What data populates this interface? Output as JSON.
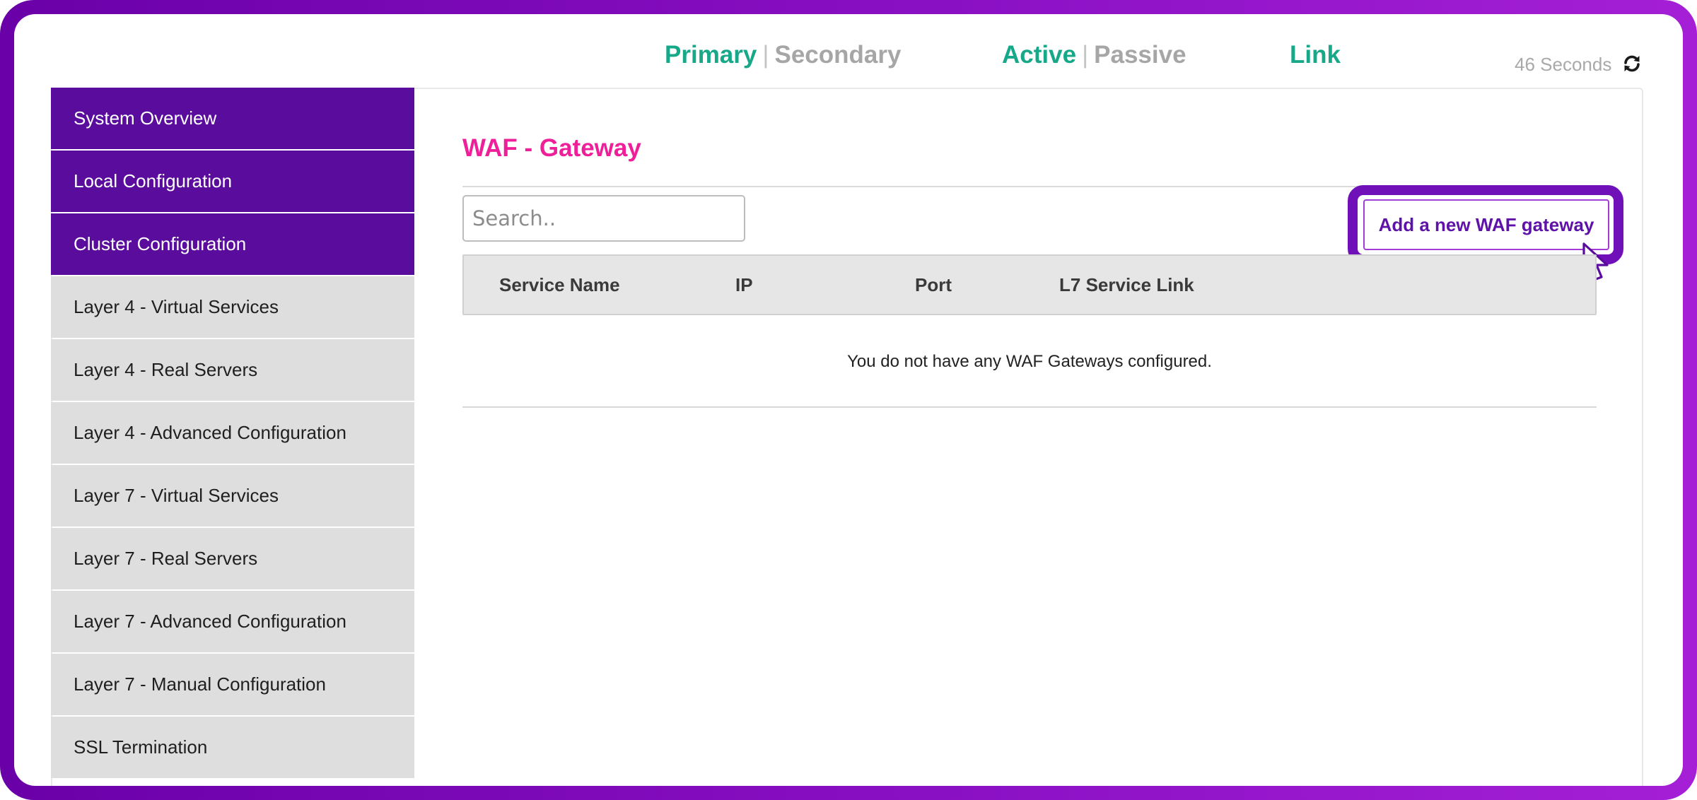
{
  "status": {
    "role_primary": "Primary",
    "role_secondary": "Secondary",
    "state_active": "Active",
    "state_passive": "Passive",
    "link": "Link",
    "separator": "|",
    "refresh_text": "46 Seconds",
    "refresh_icon": "refresh-icon",
    "active_color": "#16a888",
    "inactive_color": "#a6a6a6"
  },
  "sidebar": {
    "items": [
      {
        "label": "System Overview",
        "active": true
      },
      {
        "label": "Local Configuration",
        "active": true
      },
      {
        "label": "Cluster Configuration",
        "active": true
      },
      {
        "label": "Layer 4 - Virtual Services",
        "active": false
      },
      {
        "label": "Layer 4 - Real Servers",
        "active": false
      },
      {
        "label": "Layer 4 - Advanced Configuration",
        "active": false
      },
      {
        "label": "Layer 7 - Virtual Services",
        "active": false
      },
      {
        "label": "Layer 7 - Real Servers",
        "active": false
      },
      {
        "label": "Layer 7 - Advanced Configuration",
        "active": false
      },
      {
        "label": "Layer 7 - Manual Configuration",
        "active": false
      },
      {
        "label": "SSL Termination",
        "active": false
      }
    ],
    "active_bg": "#5a0c9c",
    "inactive_bg": "#dedede"
  },
  "main": {
    "title": "WAF - Gateway",
    "title_color": "#ef1f9a",
    "search_placeholder": "Search..",
    "search_value": "",
    "add_button_label": "Add a new WAF gateway",
    "table": {
      "columns": [
        "Service Name",
        "IP",
        "Port",
        "L7 Service Link"
      ],
      "rows": [],
      "empty_message": "You do not have any WAF Gateways configured."
    }
  }
}
